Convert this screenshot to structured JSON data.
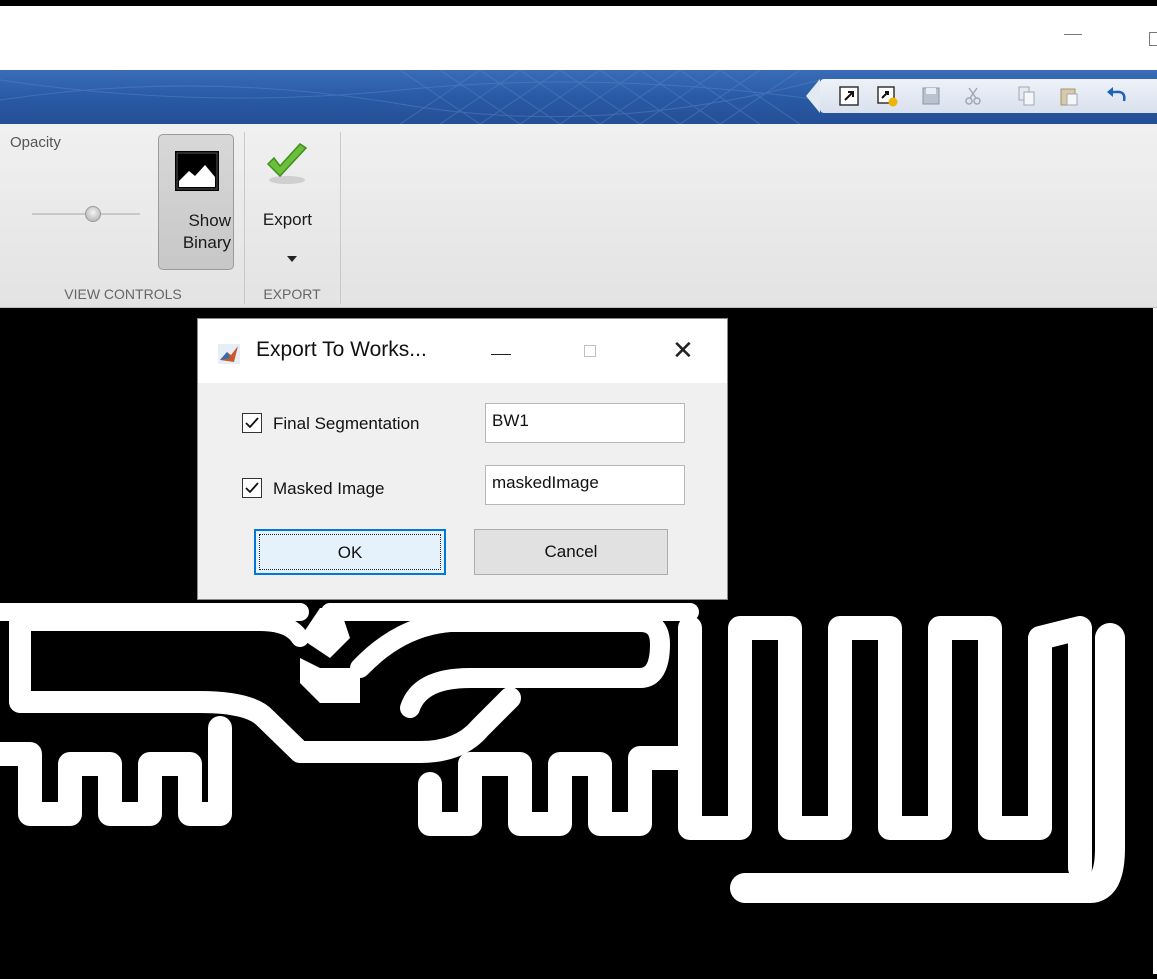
{
  "window": {
    "controls": {
      "minimize": "minimize-icon",
      "restore": "restore-icon"
    }
  },
  "quick_access_toolbar": {
    "icons": [
      "undock-icon",
      "new-window-icon",
      "save-icon",
      "cut-icon",
      "copy-icon",
      "paste-icon",
      "undo-icon"
    ]
  },
  "ribbon": {
    "view_controls": {
      "opacity_label": "Opacity",
      "show_binary": {
        "line1": "Show",
        "line2": "Binary"
      },
      "group_label": "VIEW CONTROLS"
    },
    "export": {
      "button_label": "Export",
      "group_label": "EXPORT"
    }
  },
  "dialog": {
    "title": "Export To Works...",
    "rows": [
      {
        "label": "Final Segmentation",
        "checked": true,
        "value": "BW1"
      },
      {
        "label": "Masked Image",
        "checked": true,
        "value": "maskedImage"
      }
    ],
    "ok_label": "OK",
    "cancel_label": "Cancel"
  },
  "colors": {
    "header_blue": "#2a5aa5",
    "ok_focus_border": "#0078d7",
    "check_green": "#6bbf3a"
  }
}
